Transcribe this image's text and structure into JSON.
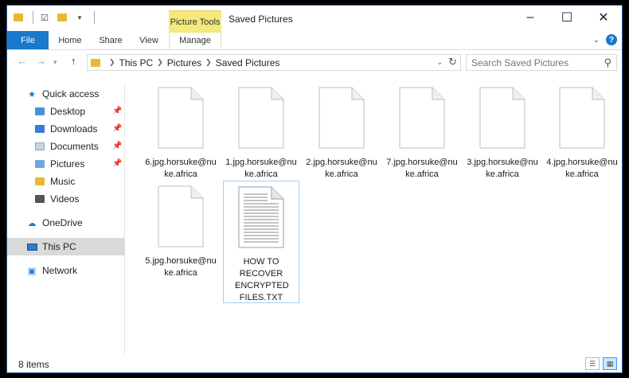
{
  "window": {
    "title": "Saved Pictures",
    "context_tab_group": "Picture Tools"
  },
  "ribbon": {
    "tabs": [
      {
        "label": "File"
      },
      {
        "label": "Home"
      },
      {
        "label": "Share"
      },
      {
        "label": "View"
      },
      {
        "label": "Manage"
      }
    ]
  },
  "address": {
    "crumbs": [
      "This PC",
      "Pictures",
      "Saved Pictures"
    ]
  },
  "search": {
    "placeholder": "Search Saved Pictures"
  },
  "sidebar": {
    "quick_access": "Quick access",
    "items": [
      {
        "label": "Desktop",
        "pinned": true
      },
      {
        "label": "Downloads",
        "pinned": true
      },
      {
        "label": "Documents",
        "pinned": true
      },
      {
        "label": "Pictures",
        "pinned": true
      },
      {
        "label": "Music",
        "pinned": false
      },
      {
        "label": "Videos",
        "pinned": false
      }
    ],
    "onedrive": "OneDrive",
    "this_pc": "This PC",
    "network": "Network"
  },
  "files": [
    {
      "name": "6.jpg.horsuke@nuke.africa",
      "type": "blank"
    },
    {
      "name": "1.jpg.horsuke@nuke.africa",
      "type": "blank"
    },
    {
      "name": "2.jpg.horsuke@nuke.africa",
      "type": "blank"
    },
    {
      "name": "7.jpg.horsuke@nuke.africa",
      "type": "blank"
    },
    {
      "name": "3.jpg.horsuke@nuke.africa",
      "type": "blank"
    },
    {
      "name": "4.jpg.horsuke@nuke.africa",
      "type": "blank"
    },
    {
      "name": "5.jpg.horsuke@nuke.africa",
      "type": "blank"
    },
    {
      "name": "HOW TO RECOVER ENCRYPTED FILES.TXT",
      "type": "text"
    }
  ],
  "status": {
    "item_count": "8 items"
  },
  "colors": {
    "accent": "#1979ca",
    "picture_tools": "#f4e97a",
    "selection": "#99d1ff"
  }
}
